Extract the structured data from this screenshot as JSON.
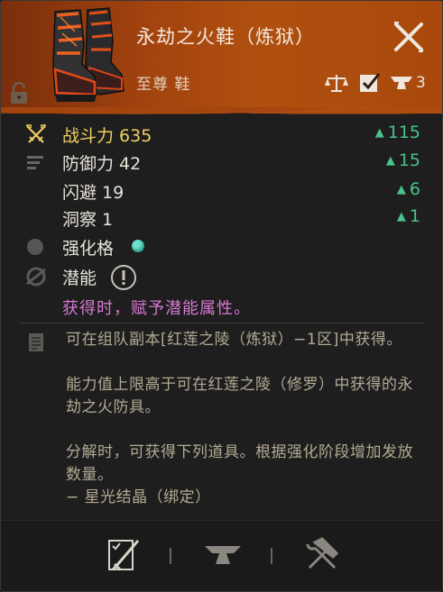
{
  "item": {
    "name": "永劫之火鞋（炼狱）",
    "grade": "至尊 鞋",
    "count": "3"
  },
  "stats": [
    {
      "label": "战斗力 635",
      "delta": "115"
    },
    {
      "label": "防御力 42",
      "delta": "15"
    },
    {
      "label": "闪避 19",
      "delta": "6"
    },
    {
      "label": "洞察 1",
      "delta": "1"
    }
  ],
  "enhance": {
    "label": "强化格"
  },
  "potential": {
    "label": "潜能",
    "description": "获得时，赋予潜能属性。"
  },
  "description": {
    "lines": [
      "可在组队副本[红莲之陵（炼狱）−1区]中获得。",
      "能力值上限高于可在红莲之陵（修罗）中获得的永劫之火防具。",
      "分解时，可获得下列道具。根据强化阶段增加发放数量。",
      "− 星光结晶（绑定）"
    ]
  },
  "colors": {
    "header": "#a4440f",
    "power_text": "#f1cf62",
    "delta_green": "#48c389",
    "potential_magenta": "#d778d3",
    "desc_text": "#b3aa94",
    "gem": "#2a9f8e"
  },
  "icons": [
    "boots-item-icon",
    "lock-icon",
    "close-icon",
    "scale-icon",
    "checkbox-icon",
    "anvil-icon",
    "crossed-swords-icon",
    "bars-icon",
    "circle-icon",
    "gem-icon",
    "swirl-icon",
    "info-icon",
    "document-icon",
    "checklist-sword-icon",
    "hammer-wrench-icon"
  ]
}
